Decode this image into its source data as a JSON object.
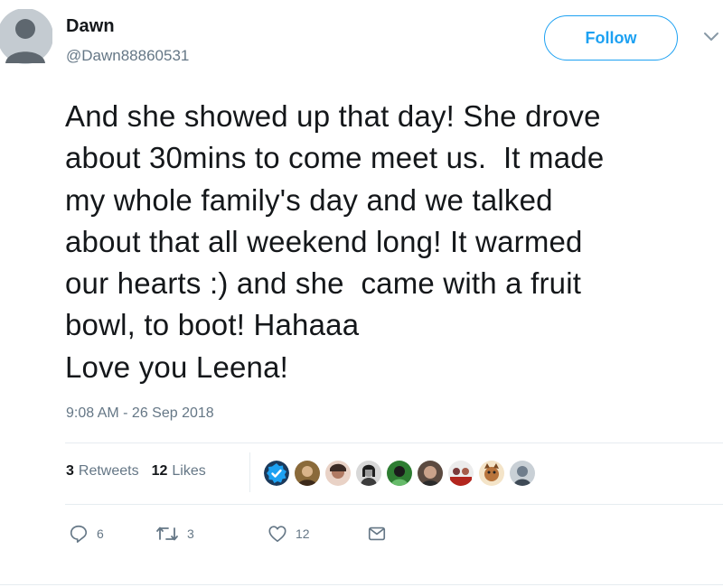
{
  "tweet": {
    "author": {
      "display_name": "Dawn",
      "handle": "@Dawn88860531",
      "avatar_icon": "default-avatar-icon"
    },
    "follow_label": "Follow",
    "menu_icon": "chevron-down-icon",
    "text": "And she showed up that day! She drove\nabout 30mins to come meet us.  It made\nmy whole family's day and we talked\nabout that all weekend long! It warmed\nour hearts :) and she  came with a fruit\nbowl, to boot! Hahaaa\nLove you Leena!",
    "timestamp": "9:08 AM - 26 Sep 2018",
    "stats": {
      "retweets_count": "3",
      "retweets_label": "Retweets",
      "likes_count": "12",
      "likes_label": "Likes"
    },
    "likers": [
      {
        "name": "liker-avatar-1",
        "icon": "verified-badge-icon",
        "color": "#1da1f2"
      },
      {
        "name": "liker-avatar-2",
        "color": "#8a6a3a"
      },
      {
        "name": "liker-avatar-3",
        "color": "#b07a63"
      },
      {
        "name": "liker-avatar-4",
        "color": "#3c3c3c"
      },
      {
        "name": "liker-avatar-5",
        "color": "#2e7d32"
      },
      {
        "name": "liker-avatar-6",
        "color": "#5b4a40"
      },
      {
        "name": "liker-avatar-7",
        "color": "#7a3a3a"
      },
      {
        "name": "liker-avatar-8",
        "color": "#b8743c"
      },
      {
        "name": "liker-avatar-9",
        "color": "#6f7d8c"
      }
    ],
    "actions": {
      "reply_count": "6",
      "retweet_count": "3",
      "like_count": "12",
      "reply_icon": "reply-icon",
      "retweet_icon": "retweet-icon",
      "like_icon": "heart-icon",
      "dm_icon": "envelope-icon"
    },
    "colors": {
      "accent": "#1da1f2",
      "muted_text": "#657786",
      "text": "#14171a",
      "divider": "#e6ecf0"
    }
  }
}
